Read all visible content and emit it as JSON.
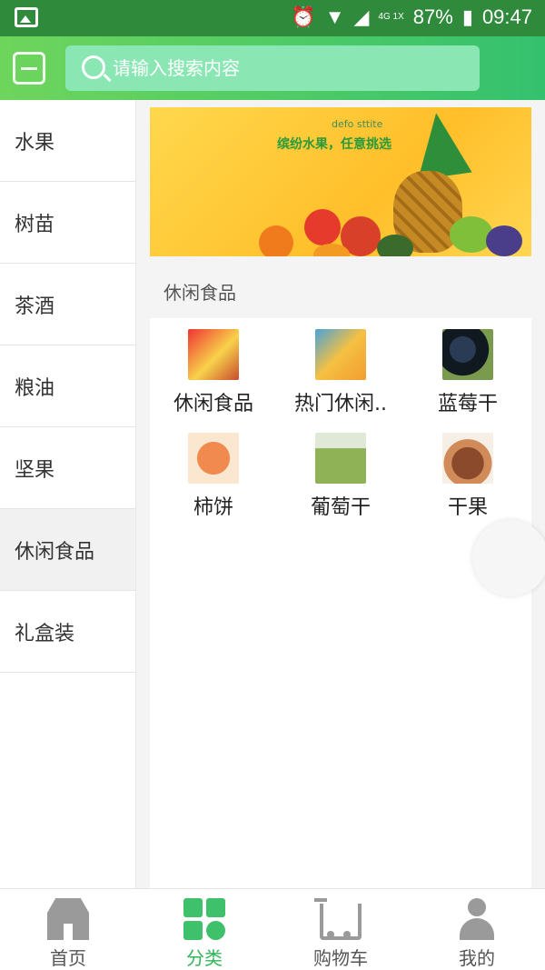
{
  "status_bar": {
    "battery": "87%",
    "time": "09:47",
    "network": "4G 1X"
  },
  "search": {
    "placeholder": "请输入搜索内容"
  },
  "sidebar": {
    "items": [
      {
        "label": "水果"
      },
      {
        "label": "树苗"
      },
      {
        "label": "茶酒"
      },
      {
        "label": "粮油"
      },
      {
        "label": "坚果"
      },
      {
        "label": "休闲食品"
      },
      {
        "label": "礼盒装"
      }
    ],
    "selected": "休闲食品"
  },
  "banner": {
    "brand": "defo sttite",
    "slogan": "缤纷水果，任意挑选"
  },
  "section": {
    "title": "休闲食品"
  },
  "products": [
    {
      "label": "休闲食品"
    },
    {
      "label": "热门休闲.."
    },
    {
      "label": "蓝莓干"
    },
    {
      "label": "柿饼"
    },
    {
      "label": "葡萄干"
    },
    {
      "label": "干果"
    }
  ],
  "tabbar": {
    "items": [
      {
        "label": "首页",
        "icon": "home-icon"
      },
      {
        "label": "分类",
        "icon": "category-icon"
      },
      {
        "label": "购物车",
        "icon": "cart-icon"
      },
      {
        "label": "我的",
        "icon": "user-icon"
      }
    ],
    "active": "分类",
    "accent_color": "#32b65a"
  }
}
